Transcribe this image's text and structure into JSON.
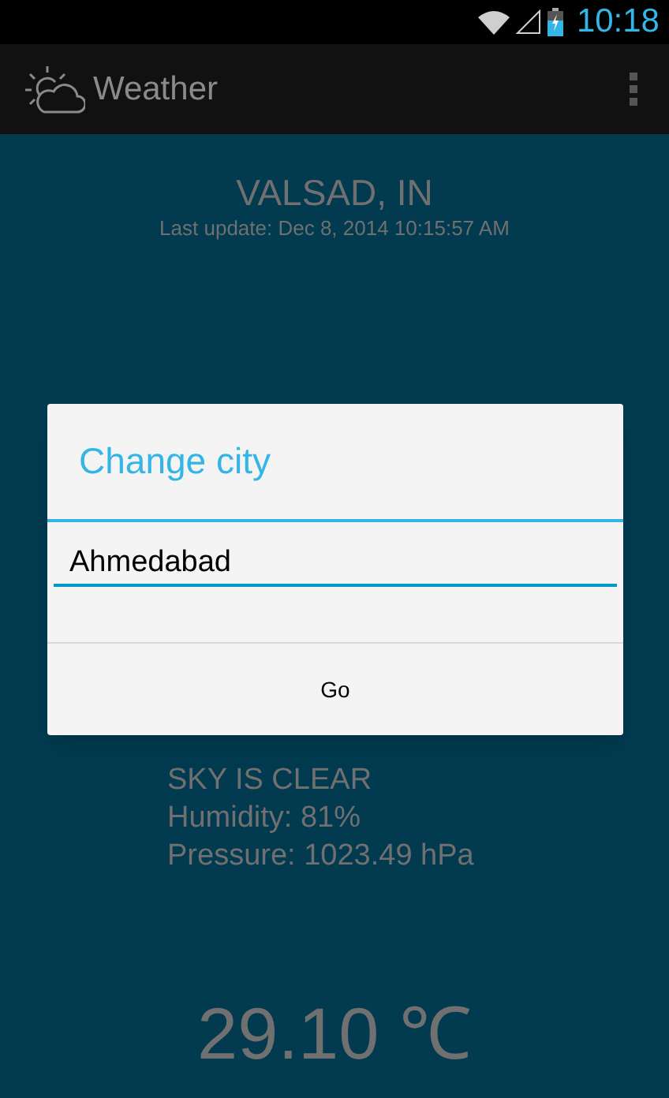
{
  "status_bar": {
    "time": "10:18"
  },
  "app_bar": {
    "title": "Weather"
  },
  "weather": {
    "city": "VALSAD, IN",
    "last_update": "Last update: Dec 8, 2014 10:15:57 AM",
    "details": [
      "SKY IS CLEAR",
      "Humidity: 81%",
      "Pressure: 1023.49 hPa"
    ],
    "temperature": "29.10 ℃"
  },
  "dialog": {
    "title": "Change city",
    "input_value": "Ahmedabad",
    "button": "Go"
  }
}
